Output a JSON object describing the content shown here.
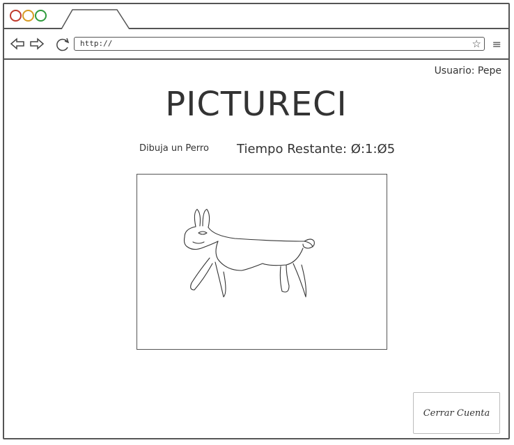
{
  "browser": {
    "url": "http://"
  },
  "header": {
    "user_label": "Usuario: Pepe"
  },
  "game": {
    "title": "PICTURECI",
    "prompt": "Dibuja un Perro",
    "timer": "Tiempo Restante: Ø:1:Ø5"
  },
  "actions": {
    "close_account": "Cerrar Cuenta"
  }
}
